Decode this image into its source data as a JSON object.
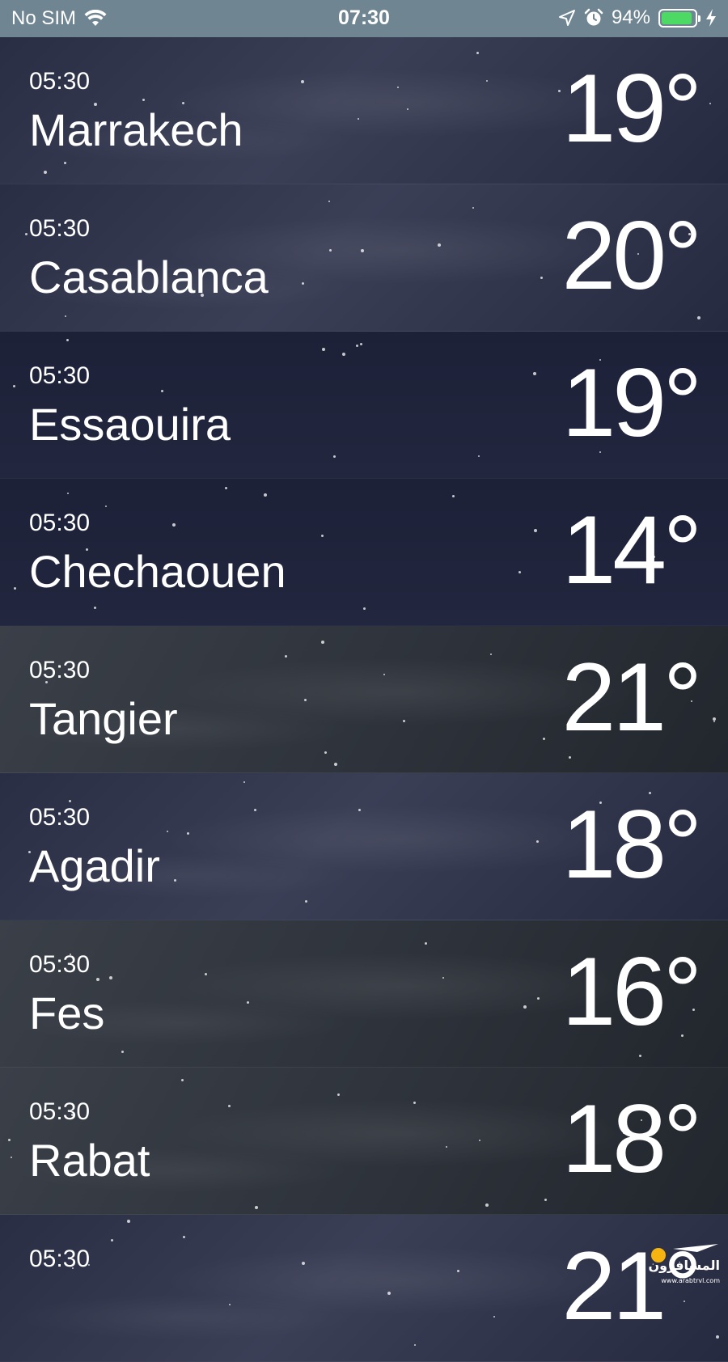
{
  "status_bar": {
    "carrier": "No SIM",
    "time": "07:30",
    "battery_percent": "94%",
    "battery_level": 0.94,
    "battery_color": "#4cd964",
    "icons": [
      "wifi-icon",
      "location-icon",
      "alarm-icon",
      "battery-icon",
      "charge-icon"
    ]
  },
  "cities": [
    {
      "time": "05:30",
      "name": "Marrakech",
      "temp": "19°"
    },
    {
      "time": "05:30",
      "name": "Casablanca",
      "temp": "20°"
    },
    {
      "time": "05:30",
      "name": "Essaouira",
      "temp": "19°"
    },
    {
      "time": "05:30",
      "name": "Chechaouen",
      "temp": "14°"
    },
    {
      "time": "05:30",
      "name": "Tangier",
      "temp": "21°"
    },
    {
      "time": "05:30",
      "name": "Agadir",
      "temp": "18°"
    },
    {
      "time": "05:30",
      "name": "Fes",
      "temp": "16°"
    },
    {
      "time": "05:30",
      "name": "Rabat",
      "temp": "18°"
    },
    {
      "time": "05:30",
      "name": "",
      "temp": "21°"
    }
  ],
  "watermark": {
    "text": "المسافرون العرب",
    "subtext": "www.arabtrvl.com"
  }
}
